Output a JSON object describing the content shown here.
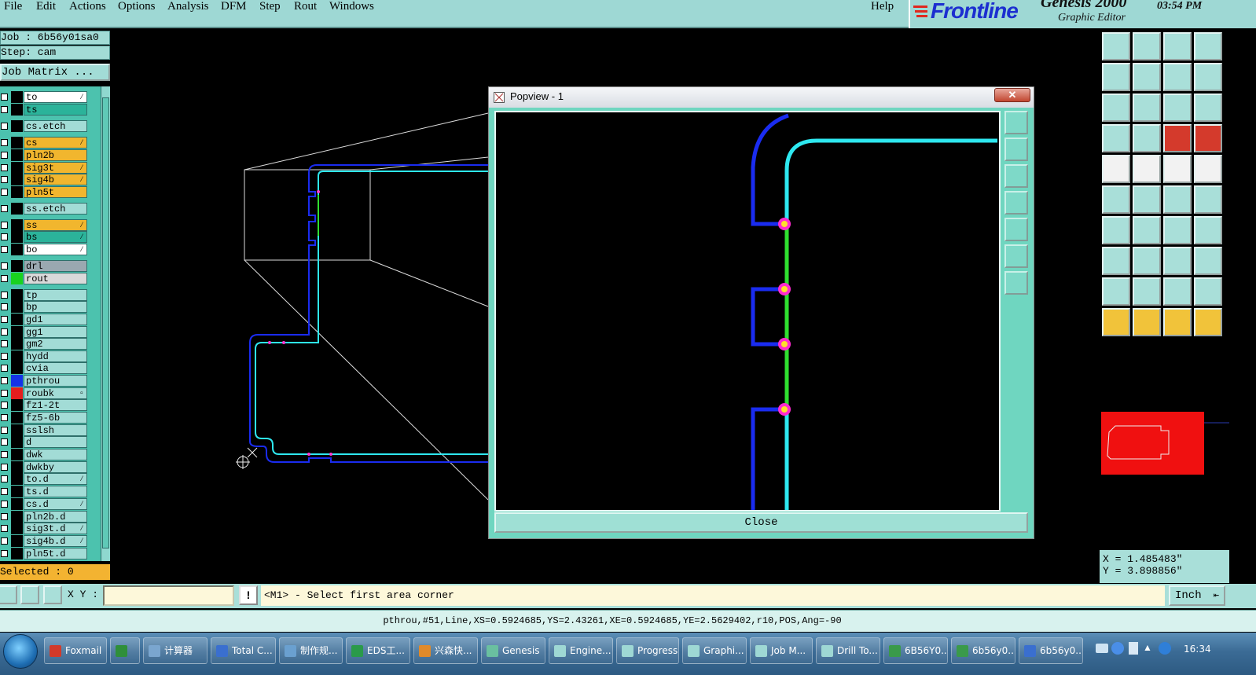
{
  "menu": [
    "File",
    "Edit",
    "Actions",
    "Options",
    "Analysis",
    "DFM",
    "Step",
    "Rout",
    "Windows"
  ],
  "help": "Help",
  "brand": {
    "logo": "Frontline",
    "product": "Genesis 2000",
    "subtitle": "Graphic Editor",
    "time": "03:54 PM"
  },
  "job": {
    "job_line": "Job : 6b56y01sa0",
    "step_line": "Step: cam",
    "matrix_button": "Job Matrix ..."
  },
  "layers": [
    {
      "name": "to",
      "bg": "#ffffff",
      "mark": "⁄"
    },
    {
      "name": "ts",
      "bg": "#2bb39a",
      "mark": ""
    },
    {
      "name": "cs.etch",
      "bg": "#a2dcd6",
      "mark": ""
    },
    {
      "name": "cs",
      "bg": "#f1b62e",
      "mark": "⁄"
    },
    {
      "name": "pln2b",
      "bg": "#f1b62e",
      "mark": ""
    },
    {
      "name": "sig3t",
      "bg": "#f1b62e",
      "mark": "⁄"
    },
    {
      "name": "sig4b",
      "bg": "#f1b62e",
      "mark": "⁄"
    },
    {
      "name": "pln5t",
      "bg": "#f1b62e",
      "mark": ""
    },
    {
      "name": "ss.etch",
      "bg": "#a2dcd6",
      "mark": ""
    },
    {
      "name": "ss",
      "bg": "#f1b62e",
      "mark": "⁄"
    },
    {
      "name": "bs",
      "bg": "#2bb39a",
      "mark": "⁄"
    },
    {
      "name": "bo",
      "bg": "#ffffff",
      "mark": "⁄"
    },
    {
      "name": "drl",
      "bg": "#9aa8b0",
      "mark": ""
    },
    {
      "name": "rout",
      "bg": "#d9d9d9",
      "mark": "",
      "swatch": "#19d21f"
    },
    {
      "name": "tp",
      "bg": "#a2dcd6",
      "mark": ""
    },
    {
      "name": "bp",
      "bg": "#a2dcd6",
      "mark": ""
    },
    {
      "name": "gd1",
      "bg": "#a2dcd6",
      "mark": ""
    },
    {
      "name": "gg1",
      "bg": "#a2dcd6",
      "mark": ""
    },
    {
      "name": "gm2",
      "bg": "#a2dcd6",
      "mark": ""
    },
    {
      "name": "hydd",
      "bg": "#a2dcd6",
      "mark": ""
    },
    {
      "name": "cvia",
      "bg": "#a2dcd6",
      "mark": ""
    },
    {
      "name": "pthrou",
      "bg": "#a2dcd6",
      "mark": "",
      "swatch": "#1432e8"
    },
    {
      "name": "roubk",
      "bg": "#a2dcd6",
      "mark": "▫",
      "swatch": "#e41e1e"
    },
    {
      "name": "fz1-2t",
      "bg": "#a2dcd6",
      "mark": ""
    },
    {
      "name": "fz5-6b",
      "bg": "#a2dcd6",
      "mark": ""
    },
    {
      "name": "sslsh",
      "bg": "#a2dcd6",
      "mark": ""
    },
    {
      "name": "d",
      "bg": "#a2dcd6",
      "mark": ""
    },
    {
      "name": "dwk",
      "bg": "#a2dcd6",
      "mark": ""
    },
    {
      "name": "dwkby",
      "bg": "#a2dcd6",
      "mark": ""
    },
    {
      "name": "to.d",
      "bg": "#a2dcd6",
      "mark": "⁄"
    },
    {
      "name": "ts.d",
      "bg": "#a2dcd6",
      "mark": ""
    },
    {
      "name": "cs.d",
      "bg": "#a2dcd6",
      "mark": "⁄"
    },
    {
      "name": "pln2b.d",
      "bg": "#a2dcd6",
      "mark": ""
    },
    {
      "name": "sig3t.d",
      "bg": "#a2dcd6",
      "mark": "⁄"
    },
    {
      "name": "sig4b.d",
      "bg": "#a2dcd6",
      "mark": "⁄"
    },
    {
      "name": "pln5t.d",
      "bg": "#a2dcd6",
      "mark": ""
    }
  ],
  "selected": "Selected : 0",
  "popview": {
    "title": "Popview - 1",
    "close_x": "✕",
    "close_button": "Close"
  },
  "coords": {
    "x": "X = 1.485483\"",
    "y": "Y = 3.898856\""
  },
  "command": {
    "xy_label": "X Y :",
    "xy_value": "",
    "exclaim": "!",
    "prompt": "<M1> - Select first area corner",
    "unit": "Inch"
  },
  "status": "pthrou,#51,Line,XS=0.5924685,YS=2.43261,XE=0.5924685,YE=2.5629402,r10,POS,Ang=-90",
  "taskbar": [
    {
      "label": "Foxmail",
      "color": "#d23a2a"
    },
    {
      "label": "",
      "color": "#2f8f3a"
    },
    {
      "label": "计算器",
      "color": "#7aa6cf"
    },
    {
      "label": "Total C...",
      "color": "#3a6fcf"
    },
    {
      "label": "制作规...",
      "color": "#6aa0d0"
    },
    {
      "label": "EDS工...",
      "color": "#2a9a4a"
    },
    {
      "label": "兴森快...",
      "color": "#e08a2a"
    },
    {
      "label": "Genesis",
      "color": "#6ac0a0"
    },
    {
      "label": "Engine...",
      "color": "#9ed8d4"
    },
    {
      "label": "Progress",
      "color": "#9ed8d4"
    },
    {
      "label": "Graphi...",
      "color": "#9ed8d4"
    },
    {
      "label": "Job M...",
      "color": "#9ed8d4"
    },
    {
      "label": "Drill To...",
      "color": "#9ed8d4"
    },
    {
      "label": "6B56Y0...",
      "color": "#3a9a4a"
    },
    {
      "label": "6b56y0...",
      "color": "#3a9a4a"
    },
    {
      "label": "6b56y0...",
      "color": "#3a6fcf"
    }
  ],
  "clock": "16:34"
}
